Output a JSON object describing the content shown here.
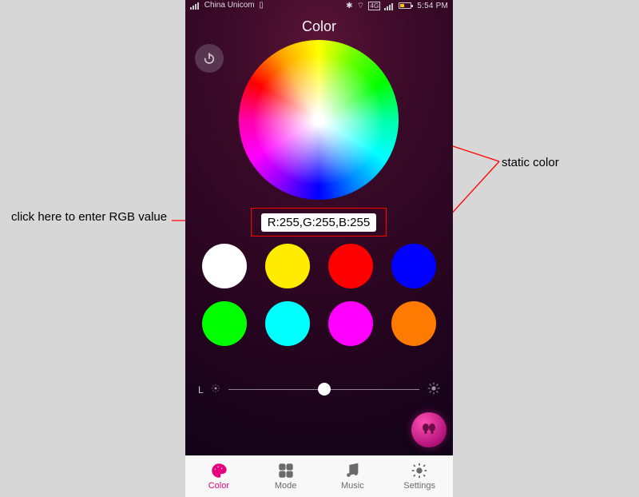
{
  "statusbar": {
    "carrier": "China Unicom",
    "time": "5:54 PM",
    "network_badge": "4G"
  },
  "screen": {
    "title": "Color"
  },
  "rgb": {
    "display": "R:255,G:255,B:255"
  },
  "presets": [
    {
      "name": "white",
      "hex": "#ffffff"
    },
    {
      "name": "yellow",
      "hex": "#ffec00"
    },
    {
      "name": "red",
      "hex": "#ff0000"
    },
    {
      "name": "blue",
      "hex": "#0000ff"
    },
    {
      "name": "green",
      "hex": "#00ff00"
    },
    {
      "name": "cyan",
      "hex": "#00ffff"
    },
    {
      "name": "magenta",
      "hex": "#ff00ff"
    },
    {
      "name": "orange",
      "hex": "#ff7a00"
    }
  ],
  "brightness": {
    "label": "L",
    "percent": 50
  },
  "tabs": {
    "color": "Color",
    "mode": "Mode",
    "music": "Music",
    "settings": "Settings",
    "active": "color"
  },
  "annotations": {
    "rgb_hint": "click here to enter RGB value",
    "static_color": "static color"
  }
}
